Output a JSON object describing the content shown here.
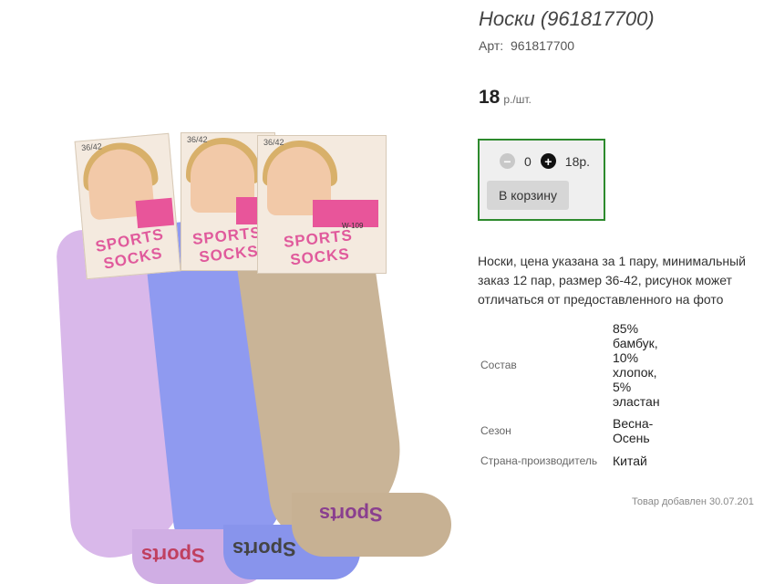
{
  "product": {
    "title": "Носки (961817700)",
    "sku_label": "Арт:",
    "sku_value": "961817700",
    "price_value": "18",
    "price_unit": "р./шт.",
    "description": "Носки, цена указана за 1 пару, минимальный заказ 12 пар, размер 36-42, рисунок может отличаться от предоставленного на фото",
    "added_note": "Товар добавлен 30.07.201"
  },
  "cart": {
    "minus_icon": "minus-circle-icon",
    "plus_icon": "plus-circle-icon",
    "quantity": "0",
    "sum": "18р.",
    "add_button_label": "В корзину",
    "border_color": "#2d8a2d"
  },
  "specs": [
    {
      "key": "Состав",
      "value": "85% бамбук, 10% хлопок, 5% эластан"
    },
    {
      "key": "Сезон",
      "value": "Весна-Осень"
    },
    {
      "key": "Страна-производитель",
      "value": "Китай"
    }
  ],
  "image": {
    "brand_text": "SPORTS SOCKS",
    "size_text": "36/42",
    "model_text": "W-109",
    "toe_text": "Sports",
    "sock_colors": [
      "#d9b8ea",
      "#8f9af0",
      "#c9b497"
    ]
  }
}
